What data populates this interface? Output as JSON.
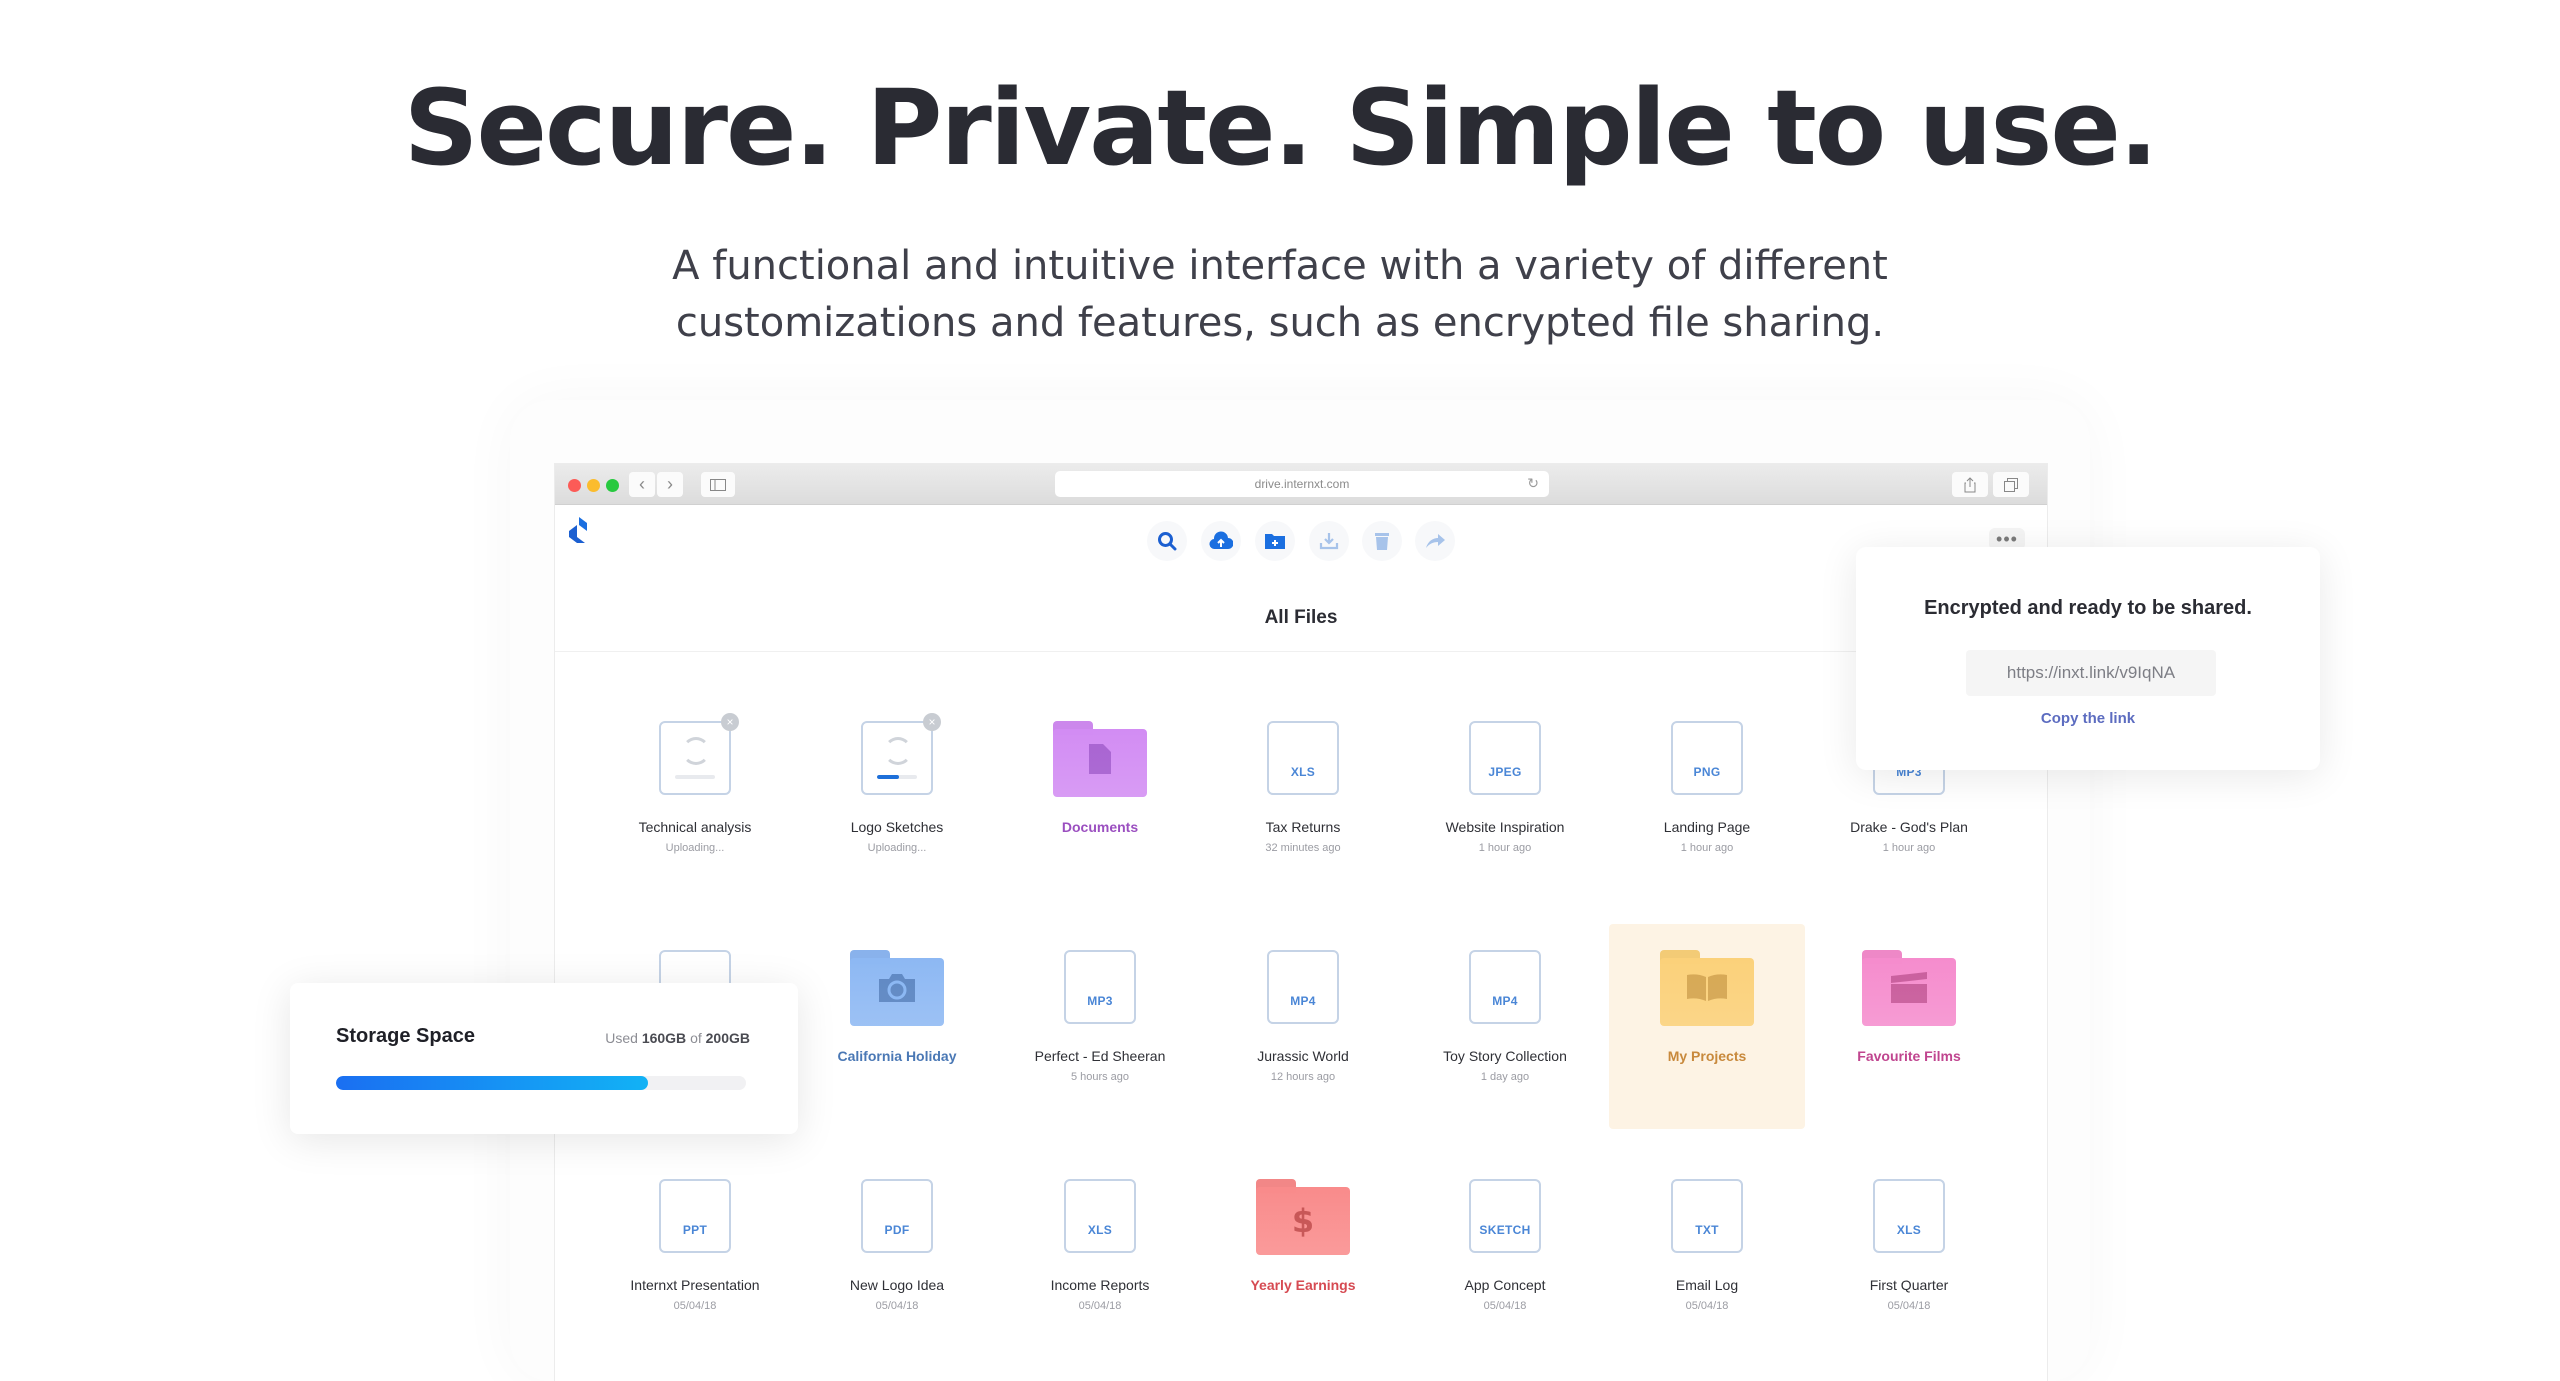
{
  "hero": {
    "title": "Secure. Private. Simple to use.",
    "subtitle_line1": "A functional and intuitive interface with a variety of different",
    "subtitle_line2": "customizations and features, such as encrypted file sharing."
  },
  "browser": {
    "url": "drive.internxt.com",
    "icons": {
      "back": "chevron-left-icon",
      "forward": "chevron-right-icon",
      "sidebar": "sidebar-icon",
      "reload": "reload-icon",
      "share": "share-icon",
      "tabs": "tabs-icon"
    }
  },
  "app": {
    "logo": "internxt-logo",
    "page_title": "All Files",
    "more_label": "•••",
    "toolbar": [
      {
        "name": "search",
        "icon": "search-icon",
        "color": "#1b5fd1"
      },
      {
        "name": "upload",
        "icon": "cloud-upload-icon",
        "color": "#1b6fe0"
      },
      {
        "name": "new-folder",
        "icon": "folder-plus-icon",
        "color": "#1b6fe0"
      },
      {
        "name": "download",
        "icon": "download-icon",
        "color": "#a7c3ea"
      },
      {
        "name": "delete",
        "icon": "trash-icon",
        "color": "#a7c3ea"
      },
      {
        "name": "share",
        "icon": "share-arrow-icon",
        "color": "#a7c3ea"
      }
    ],
    "files": [
      [
        {
          "name": "Technical analysis",
          "sub": "Uploading...",
          "kind": "uploading",
          "progress": 0
        },
        {
          "name": "Logo Sketches",
          "sub": "Uploading...",
          "kind": "uploading",
          "progress": 0.55
        },
        {
          "name": "Documents",
          "sub": "",
          "kind": "folder",
          "color": "#d28cf3",
          "text_color": "#9b4fc0",
          "glyph": "document-icon"
        },
        {
          "name": "Tax Returns",
          "sub": "32 minutes ago",
          "kind": "file",
          "ext": "XLS"
        },
        {
          "name": "Website Inspiration",
          "sub": "1 hour ago",
          "kind": "file",
          "ext": "JPEG"
        },
        {
          "name": "Landing Page",
          "sub": "1 hour ago",
          "kind": "file",
          "ext": "PNG"
        },
        {
          "name": "Drake - God's Plan",
          "sub": "1 hour ago",
          "kind": "file",
          "ext": "MP3"
        }
      ],
      [
        {
          "name": "",
          "sub": "",
          "kind": "file",
          "ext": ""
        },
        {
          "name": "California Holiday",
          "sub": "",
          "kind": "folder",
          "color": "#8db8f3",
          "text_color": "#4a78b5",
          "glyph": "camera-icon"
        },
        {
          "name": "Perfect - Ed Sheeran",
          "sub": "5 hours ago",
          "kind": "file",
          "ext": "MP3"
        },
        {
          "name": "Jurassic World",
          "sub": "12 hours ago",
          "kind": "file",
          "ext": "MP4"
        },
        {
          "name": "Toy Story Collection",
          "sub": "1 day ago",
          "kind": "file",
          "ext": "MP4"
        },
        {
          "name": "My Projects",
          "sub": "",
          "kind": "folder",
          "color": "#fbd17a",
          "text_color": "#c8893c",
          "glyph": "book-icon",
          "selected": true
        },
        {
          "name": "Favourite Films",
          "sub": "",
          "kind": "folder",
          "color": "#f58ccd",
          "text_color": "#c0458f",
          "glyph": "clapperboard-icon"
        }
      ],
      [
        {
          "name": "Internxt Presentation",
          "sub": "05/04/18",
          "kind": "file",
          "ext": "PPT"
        },
        {
          "name": "New Logo Idea",
          "sub": "05/04/18",
          "kind": "file",
          "ext": "PDF"
        },
        {
          "name": "Income Reports",
          "sub": "05/04/18",
          "kind": "file",
          "ext": "XLS"
        },
        {
          "name": "Yearly Earnings",
          "sub": "",
          "kind": "folder",
          "color": "#f98b8b",
          "text_color": "#d64a52",
          "glyph": "dollar-icon"
        },
        {
          "name": "App Concept",
          "sub": "05/04/18",
          "kind": "file",
          "ext": "SKETCH"
        },
        {
          "name": "Email Log",
          "sub": "05/04/18",
          "kind": "file",
          "ext": "TXT"
        },
        {
          "name": "First Quarter",
          "sub": "05/04/18",
          "kind": "file",
          "ext": "XLS"
        }
      ]
    ]
  },
  "share_popup": {
    "title": "Encrypted and ready to be shared.",
    "link": "https://inxt.link/v9IqNA",
    "copy_label": "Copy the link"
  },
  "storage": {
    "title": "Storage Space",
    "used_prefix": "Used",
    "used": "160GB",
    "of": "of",
    "total": "200GB",
    "fill_fraction": 0.76
  }
}
